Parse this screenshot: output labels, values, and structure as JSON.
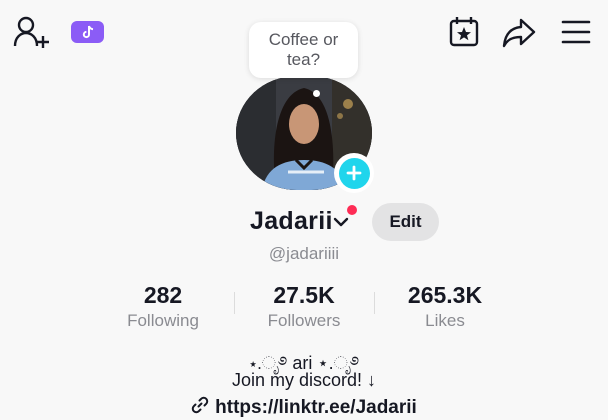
{
  "bubble": {
    "line1": "Coffee or",
    "line2": "tea?"
  },
  "profile": {
    "display_name": "Jadarii",
    "username": "@jadariiii",
    "edit_label": "Edit"
  },
  "stats": [
    {
      "value": "282",
      "label": "Following"
    },
    {
      "value": "27.5K",
      "label": "Followers"
    },
    {
      "value": "265.3K",
      "label": "Likes"
    }
  ],
  "bio": {
    "line1": "⋆.ೃ࿔ ari ⋆.ೃ࿔",
    "line2": "Join my discord! ↓",
    "link": "https://linktr.ee/Jadarii"
  },
  "icons": {
    "add_user": "add-user-icon",
    "promo": "tiktok-promo-icon",
    "calendar": "calendar-star-icon",
    "share": "share-icon",
    "menu": "menu-icon",
    "link": "link-icon"
  },
  "colors": {
    "accent_cyan": "#20d5ec",
    "notification_red": "#fe2c55",
    "promo_purple": "#8b5cf6"
  }
}
